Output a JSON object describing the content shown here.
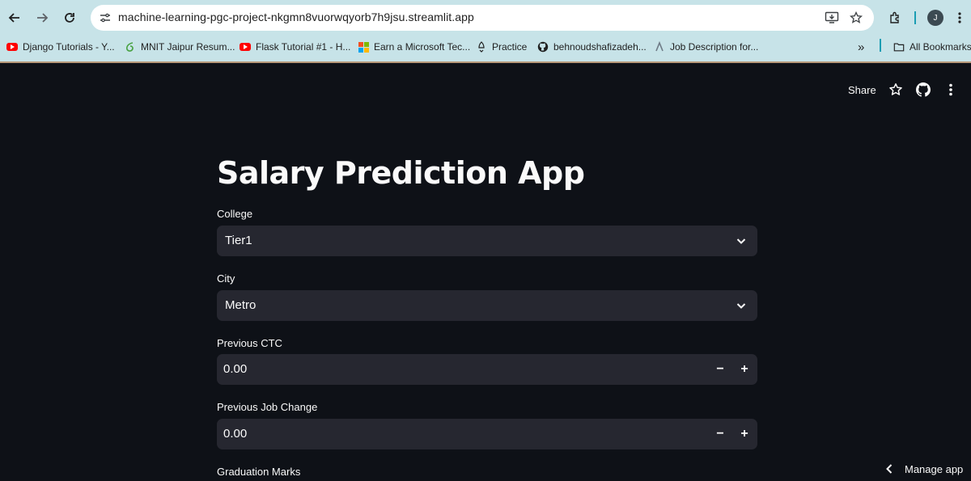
{
  "browser": {
    "url": "machine-learning-pgc-project-nkgmn8vuorwqyorb7h9jsu.streamlit.app",
    "profile_initial": "J",
    "bookmarks": [
      {
        "label": "Django Tutorials - Y...",
        "icon": "youtube-icon"
      },
      {
        "label": "MNIT Jaipur Resum...",
        "icon": "overleaf-icon"
      },
      {
        "label": "Flask Tutorial #1 - H...",
        "icon": "youtube-icon"
      },
      {
        "label": "Earn a Microsoft Tec...",
        "icon": "microsoft-icon"
      },
      {
        "label": "Practice",
        "icon": "rocket-icon"
      },
      {
        "label": "behnoudshafizadeh...",
        "icon": "github-icon"
      },
      {
        "label": "Job Description for...",
        "icon": "naukri-icon"
      }
    ],
    "more_bookmarks": "»",
    "all_bookmarks": "All Bookmarks"
  },
  "header": {
    "share": "Share"
  },
  "app": {
    "title": "Salary Prediction App",
    "fields": {
      "college": {
        "label": "College",
        "value": "Tier1"
      },
      "city": {
        "label": "City",
        "value": "Metro"
      },
      "previous_ctc": {
        "label": "Previous CTC",
        "value": "0.00"
      },
      "previous_job_change": {
        "label": "Previous Job Change",
        "value": "0.00"
      },
      "graduation_marks": {
        "label": "Graduation Marks"
      }
    },
    "stepper": {
      "minus": "−",
      "plus": "+"
    }
  },
  "footer": {
    "manage_app": "Manage app"
  },
  "colors": {
    "background": "#0e1117",
    "input_bg": "#262730",
    "text": "#fafafa",
    "chrome_bg": "#c7e3e8"
  }
}
